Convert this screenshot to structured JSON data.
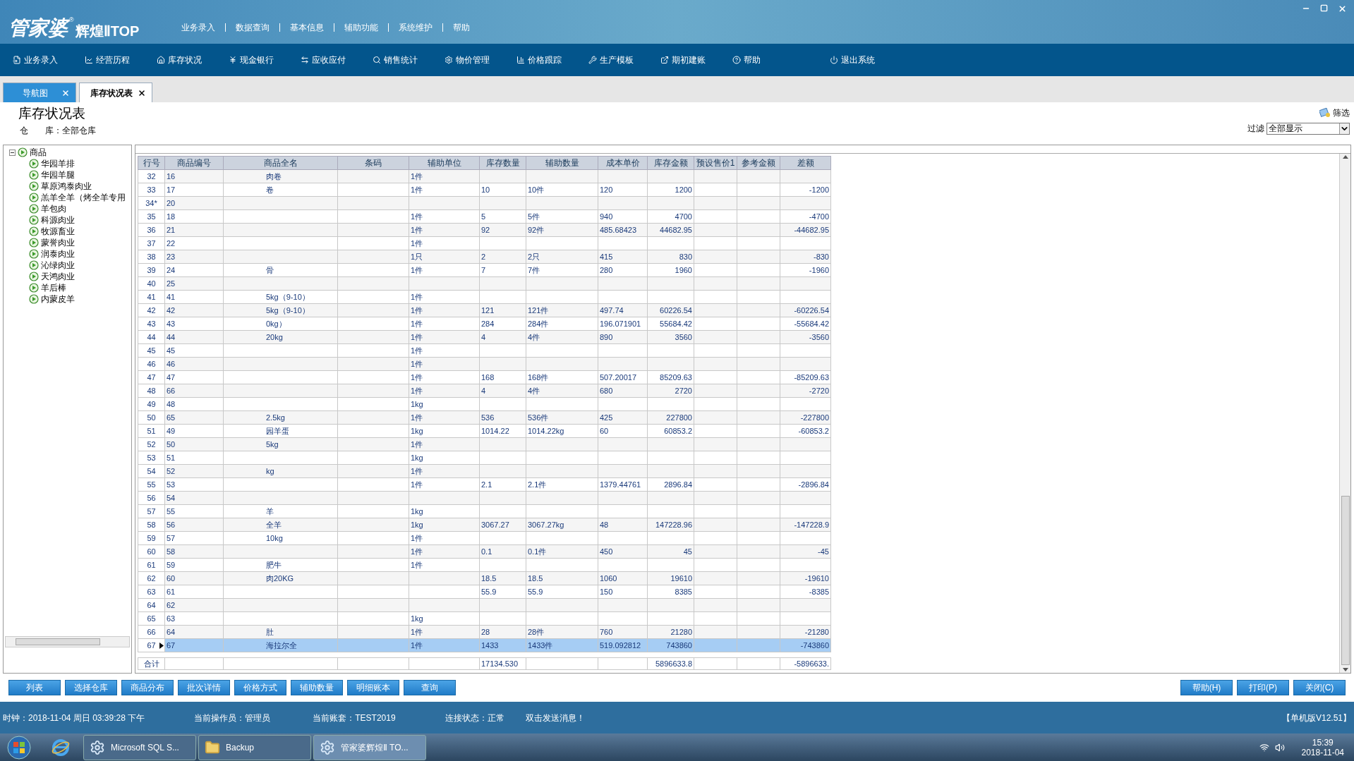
{
  "window": {
    "logo_main": "管家婆",
    "logo_sub": "辉煌ⅡTOP",
    "logo_mark": "®",
    "menu": [
      "业务录入",
      "数据查询",
      "基本信息",
      "辅助功能",
      "系统维护",
      "帮助"
    ]
  },
  "toolbar": [
    {
      "label": "业务录入"
    },
    {
      "label": "经营历程"
    },
    {
      "label": "库存状况"
    },
    {
      "label": "现金银行"
    },
    {
      "label": "应收应付"
    },
    {
      "label": "销售统计"
    },
    {
      "label": "物价管理"
    },
    {
      "label": "价格跟踪"
    },
    {
      "label": "生产模板"
    },
    {
      "label": "期初建账"
    },
    {
      "label": "帮助"
    },
    {
      "label": "退出系统"
    }
  ],
  "tabs": [
    {
      "label": "导航图",
      "selected": false
    },
    {
      "label": "库存状况表",
      "selected": true
    }
  ],
  "report": {
    "title": "库存状况表",
    "warehouse": "仓　　库：全部仓库",
    "filter_button": "筛选",
    "filter_label": "过滤",
    "filter_value": "全部显示"
  },
  "tree": {
    "label": "商品",
    "expanded": true,
    "children": [
      {
        "label": "华园羊排"
      },
      {
        "label": "华园羊腿"
      },
      {
        "label": "草原鸿泰肉业"
      },
      {
        "label": "羔羊全羊（烤全羊专用"
      },
      {
        "label": "羊包肉"
      },
      {
        "label": "科源肉业"
      },
      {
        "label": "牧源畜业"
      },
      {
        "label": "蒙誉肉业"
      },
      {
        "label": "润泰肉业"
      },
      {
        "label": "沁绿肉业"
      },
      {
        "label": "天鸿肉业"
      },
      {
        "label": "羊后棒"
      },
      {
        "label": "内蒙皮羊"
      }
    ]
  },
  "table": {
    "columns": [
      "行号",
      "商品编号",
      "商品全名",
      "条码",
      "辅助单位",
      "库存数量",
      "辅助数量",
      "成本单价",
      "库存金额",
      "预设售价1",
      "参考金额",
      "差额"
    ],
    "rows": [
      {
        "no": "32",
        "code": "16",
        "name": "肉卷",
        "unit": "1件",
        "selected": false
      },
      {
        "no": "33",
        "code": "17",
        "name": "卷",
        "unit": "1件",
        "qty": "10",
        "aux_qty": "10件",
        "cost": "120",
        "amount": "1200",
        "diff": "-1200",
        "selected": false
      },
      {
        "no": "34*",
        "code": "20",
        "selected": false
      },
      {
        "no": "35",
        "code": "18",
        "unit": "1件",
        "qty": "5",
        "aux_qty": "5件",
        "cost": "940",
        "amount": "4700",
        "diff": "-4700",
        "selected": false
      },
      {
        "no": "36",
        "code": "21",
        "unit": "1件",
        "qty": "92",
        "aux_qty": "92件",
        "cost": "485.68423",
        "amount": "44682.95",
        "diff": "-44682.95",
        "selected": false
      },
      {
        "no": "37",
        "code": "22",
        "unit": "1件",
        "selected": false
      },
      {
        "no": "38",
        "code": "23",
        "unit": "1只",
        "qty": "2",
        "aux_qty": "2只",
        "cost": "415",
        "amount": "830",
        "diff": "-830",
        "selected": false
      },
      {
        "no": "39",
        "code": "24",
        "name": "骨",
        "unit": "1件",
        "qty": "7",
        "aux_qty": "7件",
        "cost": "280",
        "amount": "1960",
        "diff": "-1960",
        "selected": false
      },
      {
        "no": "40",
        "code": "25",
        "selected": false
      },
      {
        "no": "41",
        "code": "41",
        "name": "5kg（9-10）",
        "unit": "1件",
        "selected": false
      },
      {
        "no": "42",
        "code": "42",
        "name": "5kg（9-10）",
        "unit": "1件",
        "qty": "121",
        "aux_qty": "121件",
        "cost": "497.74",
        "amount": "60226.54",
        "diff": "-60226.54",
        "selected": false
      },
      {
        "no": "43",
        "code": "43",
        "name": "0kg）",
        "unit": "1件",
        "qty": "284",
        "aux_qty": "284件",
        "cost": "196.071901",
        "amount": "55684.42",
        "diff": "-55684.42",
        "selected": false
      },
      {
        "no": "44",
        "code": "44",
        "name": "20kg",
        "unit": "1件",
        "qty": "4",
        "aux_qty": "4件",
        "cost": "890",
        "amount": "3560",
        "diff": "-3560",
        "selected": false
      },
      {
        "no": "45",
        "code": "45",
        "unit": "1件",
        "selected": false
      },
      {
        "no": "46",
        "code": "46",
        "unit": "1件",
        "selected": false
      },
      {
        "no": "47",
        "code": "47",
        "unit": "1件",
        "qty": "168",
        "aux_qty": "168件",
        "cost": "507.20017",
        "amount": "85209.63",
        "diff": "-85209.63",
        "selected": false
      },
      {
        "no": "48",
        "code": "66",
        "unit": "1件",
        "qty": "4",
        "aux_qty": "4件",
        "cost": "680",
        "amount": "2720",
        "diff": "-2720",
        "selected": false
      },
      {
        "no": "49",
        "code": "48",
        "unit": "1kg",
        "selected": false
      },
      {
        "no": "50",
        "code": "65",
        "name": "2.5kg",
        "unit": "1件",
        "qty": "536",
        "aux_qty": "536件",
        "cost": "425",
        "amount": "227800",
        "diff": "-227800",
        "selected": false
      },
      {
        "no": "51",
        "code": "49",
        "name": "园羊蛋",
        "unit": "1kg",
        "qty": "1014.22",
        "aux_qty": "1014.22kg",
        "cost": "60",
        "amount": "60853.2",
        "diff": "-60853.2",
        "selected": false
      },
      {
        "no": "52",
        "code": "50",
        "name": "5kg",
        "unit": "1件",
        "selected": false
      },
      {
        "no": "53",
        "code": "51",
        "unit": "1kg",
        "selected": false
      },
      {
        "no": "54",
        "code": "52",
        "name": "kg",
        "unit": "1件",
        "selected": false
      },
      {
        "no": "55",
        "code": "53",
        "unit": "1件",
        "qty": "2.1",
        "aux_qty": "2.1件",
        "cost": "1379.44761",
        "amount": "2896.84",
        "diff": "-2896.84",
        "selected": false
      },
      {
        "no": "56",
        "code": "54",
        "selected": false
      },
      {
        "no": "57",
        "code": "55",
        "name": "羊",
        "unit": "1kg",
        "selected": false
      },
      {
        "no": "58",
        "code": "56",
        "name": "全羊",
        "unit": "1kg",
        "qty": "3067.27",
        "aux_qty": "3067.27kg",
        "cost": "48",
        "amount": "147228.96",
        "diff": "-147228.9",
        "selected": false
      },
      {
        "no": "59",
        "code": "57",
        "name": "10kg",
        "unit": "1件",
        "selected": false
      },
      {
        "no": "60",
        "code": "58",
        "unit": "1件",
        "qty": "0.1",
        "aux_qty": "0.1件",
        "cost": "450",
        "amount": "45",
        "diff": "-45",
        "selected": false
      },
      {
        "no": "61",
        "code": "59",
        "name": "肥牛",
        "unit": "1件",
        "selected": false
      },
      {
        "no": "62",
        "code": "60",
        "name": "肉20KG",
        "qty": "18.5",
        "aux_qty": "18.5",
        "cost": "1060",
        "amount": "19610",
        "diff": "-19610",
        "selected": false
      },
      {
        "no": "63",
        "code": "61",
        "qty": "55.9",
        "aux_qty": "55.9",
        "cost": "150",
        "amount": "8385",
        "diff": "-8385",
        "selected": false
      },
      {
        "no": "64",
        "code": "62",
        "selected": false
      },
      {
        "no": "65",
        "code": "63",
        "unit": "1kg",
        "selected": false
      },
      {
        "no": "66",
        "code": "64",
        "name": "肚",
        "unit": "1件",
        "qty": "28",
        "aux_qty": "28件",
        "cost": "760",
        "amount": "21280",
        "diff": "-21280",
        "selected": false
      },
      {
        "no": "67",
        "code": "67",
        "name": "海拉尔全",
        "unit": "1件",
        "qty": "1433",
        "aux_qty": "1433件",
        "cost": "519.092812",
        "amount": "743860",
        "diff": "-743860",
        "selected": true
      }
    ],
    "total": {
      "label": "合计",
      "qty": "17134.530",
      "amount": "5896633.8",
      "diff": "-5896633."
    }
  },
  "buttons": [
    "列表",
    "选择仓库",
    "商品分布",
    "批次详情",
    "价格方式",
    "辅助数量",
    "明细账本",
    "查询"
  ],
  "right_buttons": [
    "帮助(H)",
    "打印(P)",
    "关闭(C)"
  ],
  "status_bar": {
    "items": [
      "时钟：2018-11-04 周日 03:39:28 下午",
      "当前操作员：管理员",
      "当前账套：TEST2019",
      "连接状态：正常",
      "双击发送消息！"
    ],
    "version": "【单机版V12.51】"
  },
  "taskbar": {
    "apps": [
      {
        "label": "Microsoft SQL S...",
        "selected": false
      },
      {
        "label": "Backup",
        "selected": false
      },
      {
        "label": "管家婆辉煌Ⅱ TO...",
        "selected": true
      }
    ],
    "time": "15:39",
    "date": "2018-11-04"
  }
}
